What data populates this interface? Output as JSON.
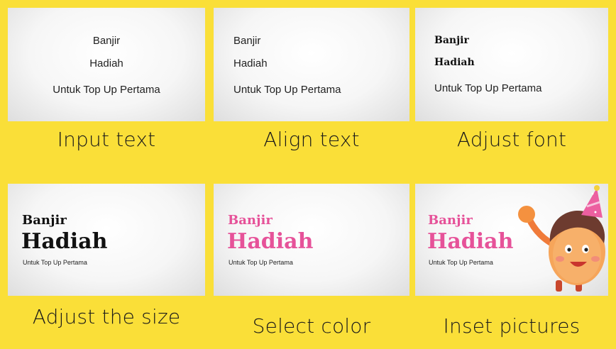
{
  "panels": [
    {
      "line1": "Banjir",
      "line2": "Hadiah",
      "line3": "Untuk Top Up Pertama",
      "caption": "Input text"
    },
    {
      "line1": "Banjir",
      "line2": "Hadiah",
      "line3": "Untuk Top Up Pertama",
      "caption": "Align text"
    },
    {
      "line1": "Banjir",
      "line2": "Hadiah",
      "line3": "Untuk Top Up Pertama",
      "caption": "Adjust font"
    },
    {
      "line1": "Banjir",
      "line2": "Hadiah",
      "line3": "Untuk Top Up Pertama",
      "caption": "Adjust the size"
    },
    {
      "line1": "Banjir",
      "line2": "Hadiah",
      "line3": "Untuk Top Up Pertama",
      "caption": "Select color"
    },
    {
      "line1": "Banjir",
      "line2": "Hadiah",
      "line3": "Untuk Top Up Pertama",
      "caption": "Inset pictures"
    }
  ],
  "colors": {
    "background": "#fadf38",
    "headline_pink": "#e65299",
    "headline_black": "#111111"
  },
  "icons": {
    "character": "cartoon-character-icon"
  }
}
